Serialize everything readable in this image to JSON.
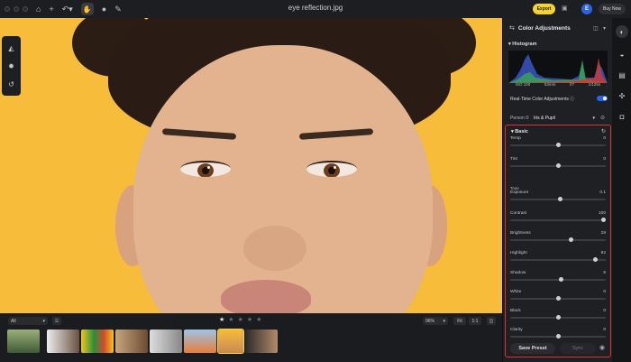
{
  "titlebar": {
    "title": "eye reflection.jpg",
    "export_label": "Export",
    "avatar_letter": "E",
    "buy_now_label": "Buy Now"
  },
  "panel": {
    "title": "Color Adjustments",
    "histogram_title": "Histogram",
    "histogram_info": [
      "ISO 100",
      "53mm",
      "f/7",
      "1/125s"
    ],
    "realtime_label": "Real-Time Color Adjustments",
    "realtime_on": true,
    "person_label": "Person 0:",
    "person_value": "Iris & Pupil",
    "basic_title": "Basic",
    "tone_label": "Tone",
    "sliders": [
      {
        "name": "Temp",
        "value": "0",
        "fraction": 0.5
      },
      {
        "name": "Tint",
        "value": "0",
        "fraction": 0.5
      },
      {
        "name": "Exposure",
        "value": "0.1",
        "fraction": 0.52
      },
      {
        "name": "Contrast",
        "value": "100",
        "fraction": 1.0
      },
      {
        "name": "Brightness",
        "value": "28",
        "fraction": 0.64
      },
      {
        "name": "Highlight",
        "value": "82",
        "fraction": 0.91
      },
      {
        "name": "Shadow",
        "value": "6",
        "fraction": 0.53
      },
      {
        "name": "White",
        "value": "0",
        "fraction": 0.5
      },
      {
        "name": "Black",
        "value": "0",
        "fraction": 0.5
      },
      {
        "name": "Clarity",
        "value": "0",
        "fraction": 0.5
      }
    ],
    "save_preset_label": "Save Preset",
    "sync_label": "Sync"
  },
  "filmstrip": {
    "filter_value": "All",
    "zoom_value": "96%",
    "fit_label": "Fit",
    "one_to_one_label": "1:1",
    "rating_stars": 5,
    "rating_value": 1
  },
  "colors": {
    "accent_yellow": "#f5d432",
    "accent_blue": "#2b63e3",
    "highlight_red": "#e0332e",
    "photo_background": "#f6bc3a"
  },
  "icons": {
    "left_tools": [
      "ai-adjust-icon",
      "settings-sun-icon",
      "history-icon"
    ],
    "right_bar": [
      "color-adjust-icon",
      "face-icon",
      "crop-icon",
      "puzzle-icon",
      "camera-icon"
    ]
  }
}
